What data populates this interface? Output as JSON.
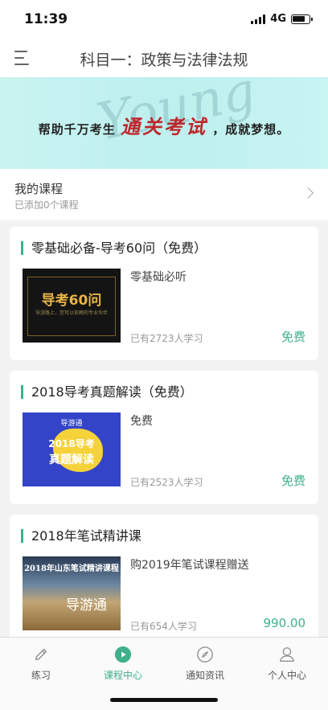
{
  "status": {
    "time": "11:39",
    "network": "4G"
  },
  "navbar": {
    "title": "科目一：政策与法律法规",
    "menu_icon": "hamburger-menu-icon"
  },
  "banner": {
    "bg_text": "Young",
    "text_before": "帮助千万考生",
    "text_highlight": "通关考试",
    "text_after": "，成就梦想。",
    "highlight_color": "#c0262d"
  },
  "my_course": {
    "title": "我的课程",
    "subtitle": "已添加0个课程"
  },
  "courses": [
    {
      "title": "零基础必备-导考60问（免费）",
      "subtitle": "零基础必听",
      "count": "已有2723人学习",
      "price": "免费",
      "thumb_text": "导考60问",
      "thumb_sub": "导游路上，您可以依赖的专业伙伴"
    },
    {
      "title": "2018导考真题解读（免费）",
      "subtitle": "免费",
      "count": "已有2523人学习",
      "price": "免费",
      "thumb_tag": "导游通",
      "thumb_line1": "2018导考",
      "thumb_line2": "真题解读"
    },
    {
      "title": "2018年笔试精讲课",
      "subtitle": "购2019年笔试课程赠送",
      "count": "已有654人学习",
      "price": "990.00",
      "thumb_head": "2018年山东笔试精讲课程",
      "thumb_logo": "导游通"
    }
  ],
  "tabs": [
    {
      "label": "练习",
      "icon": "pencil-icon",
      "active": false
    },
    {
      "label": "课程中心",
      "icon": "play-icon",
      "active": true
    },
    {
      "label": "通知资讯",
      "icon": "compass-icon",
      "active": false
    },
    {
      "label": "个人中心",
      "icon": "person-icon",
      "active": false
    }
  ],
  "colors": {
    "accent": "#3fb08a",
    "banner_bg": "#c3f1ef"
  }
}
